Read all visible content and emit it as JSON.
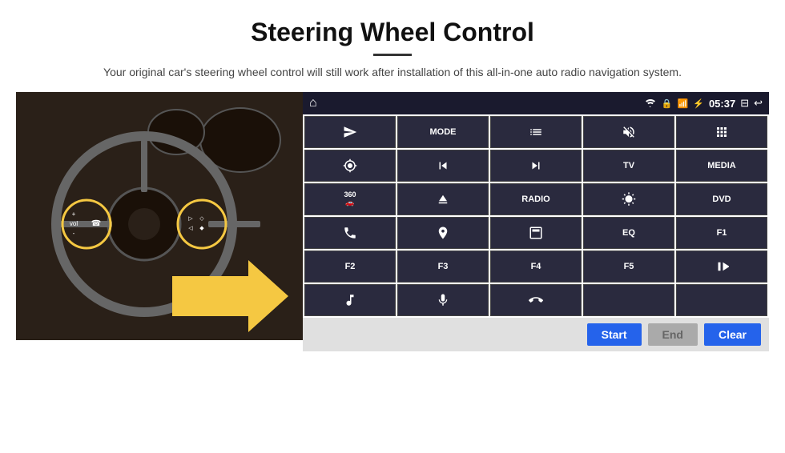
{
  "header": {
    "title": "Steering Wheel Control",
    "subtitle": "Your original car's steering wheel control will still work after installation of this all-in-one auto radio navigation system."
  },
  "status_bar": {
    "home_icon": "⌂",
    "wifi_icon": "wifi",
    "lock_icon": "lock",
    "sim_icon": "sim",
    "bt_icon": "bt",
    "time": "05:37",
    "screen_icon": "screen",
    "back_icon": "back"
  },
  "grid_buttons": [
    {
      "id": "send",
      "label": "",
      "icon": "send",
      "row": 1,
      "col": 1
    },
    {
      "id": "mode",
      "label": "MODE",
      "icon": "",
      "row": 1,
      "col": 2
    },
    {
      "id": "list",
      "label": "",
      "icon": "list",
      "row": 1,
      "col": 3
    },
    {
      "id": "mute",
      "label": "",
      "icon": "mute",
      "row": 1,
      "col": 4
    },
    {
      "id": "apps",
      "label": "",
      "icon": "apps",
      "row": 1,
      "col": 5
    },
    {
      "id": "settings",
      "label": "",
      "icon": "settings",
      "row": 2,
      "col": 1
    },
    {
      "id": "prev",
      "label": "",
      "icon": "prev",
      "row": 2,
      "col": 2
    },
    {
      "id": "next",
      "label": "",
      "icon": "next",
      "row": 2,
      "col": 3
    },
    {
      "id": "tv",
      "label": "TV",
      "icon": "",
      "row": 2,
      "col": 4
    },
    {
      "id": "media",
      "label": "MEDIA",
      "icon": "",
      "row": 2,
      "col": 5
    },
    {
      "id": "cam360",
      "label": "",
      "icon": "360cam",
      "row": 3,
      "col": 1
    },
    {
      "id": "eject",
      "label": "",
      "icon": "eject",
      "row": 3,
      "col": 2
    },
    {
      "id": "radio",
      "label": "RADIO",
      "icon": "",
      "row": 3,
      "col": 3
    },
    {
      "id": "brightness",
      "label": "",
      "icon": "brightness",
      "row": 3,
      "col": 4
    },
    {
      "id": "dvd",
      "label": "DVD",
      "icon": "",
      "row": 3,
      "col": 5
    },
    {
      "id": "phone",
      "label": "",
      "icon": "phone",
      "row": 4,
      "col": 1
    },
    {
      "id": "nav",
      "label": "",
      "icon": "nav",
      "row": 4,
      "col": 2
    },
    {
      "id": "screen-mirror",
      "label": "",
      "icon": "screenmirror",
      "row": 4,
      "col": 3
    },
    {
      "id": "eq",
      "label": "EQ",
      "icon": "",
      "row": 4,
      "col": 4
    },
    {
      "id": "f1",
      "label": "F1",
      "icon": "",
      "row": 4,
      "col": 5
    },
    {
      "id": "f2",
      "label": "F2",
      "icon": "",
      "row": 5,
      "col": 1
    },
    {
      "id": "f3",
      "label": "F3",
      "icon": "",
      "row": 5,
      "col": 2
    },
    {
      "id": "f4",
      "label": "F4",
      "icon": "",
      "row": 5,
      "col": 3
    },
    {
      "id": "f5",
      "label": "F5",
      "icon": "",
      "row": 5,
      "col": 4
    },
    {
      "id": "playpause",
      "label": "",
      "icon": "playpause",
      "row": 5,
      "col": 5
    },
    {
      "id": "music",
      "label": "",
      "icon": "music",
      "row": 6,
      "col": 1
    },
    {
      "id": "mic",
      "label": "",
      "icon": "mic",
      "row": 6,
      "col": 2
    },
    {
      "id": "call-end",
      "label": "",
      "icon": "callend",
      "row": 6,
      "col": 3
    },
    {
      "id": "empty1",
      "label": "",
      "icon": "",
      "row": 6,
      "col": 4
    },
    {
      "id": "empty2",
      "label": "",
      "icon": "",
      "row": 6,
      "col": 5
    }
  ],
  "bottom_bar": {
    "start_label": "Start",
    "end_label": "End",
    "clear_label": "Clear"
  }
}
